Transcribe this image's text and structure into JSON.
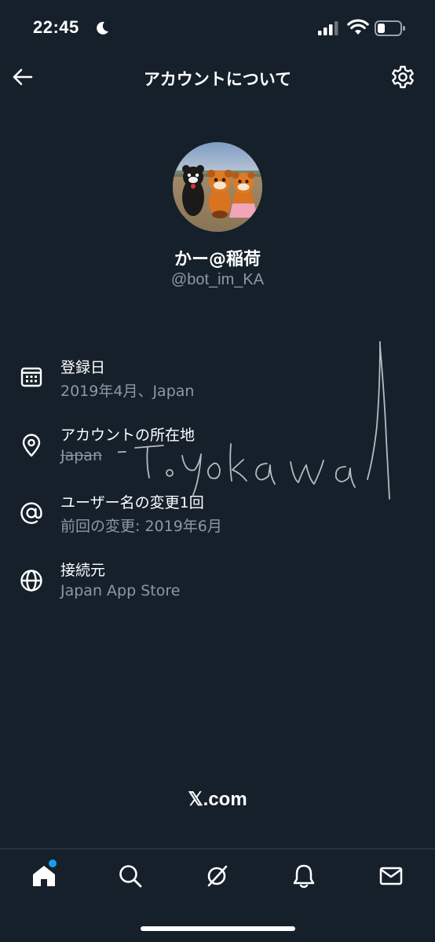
{
  "status_bar": {
    "time": "22:45"
  },
  "header": {
    "title": "アカウントについて"
  },
  "profile": {
    "display_name": "かー@稲荷",
    "handle": "@bot_im_KA"
  },
  "info": {
    "joined": {
      "label": "登録日",
      "value": "2019年4月、Japan",
      "icon": "calendar-icon"
    },
    "location": {
      "label": "アカウントの所在地",
      "value": "Japan",
      "icon": "location-pin-icon"
    },
    "username_changes": {
      "label": "ユーザー名の変更1回",
      "value": "前回の変更: 2019年6月",
      "icon": "at-sign-icon"
    },
    "connected_via": {
      "label": "接続元",
      "value": "Japan App Store",
      "icon": "globe-icon"
    }
  },
  "footer": {
    "brand": "𝕏.com"
  },
  "tabs": [
    {
      "name": "home",
      "icon": "home-icon",
      "has_badge": true
    },
    {
      "name": "search",
      "icon": "search-icon"
    },
    {
      "name": "grok",
      "icon": "grok-icon"
    },
    {
      "name": "notifications",
      "icon": "bell-icon"
    },
    {
      "name": "messages",
      "icon": "mail-icon"
    }
  ],
  "colors": {
    "background": "#15202b",
    "primary_text": "#ffffff",
    "secondary_text": "#8b98a5",
    "accent": "#1d9bf0",
    "divider": "#38444d"
  }
}
